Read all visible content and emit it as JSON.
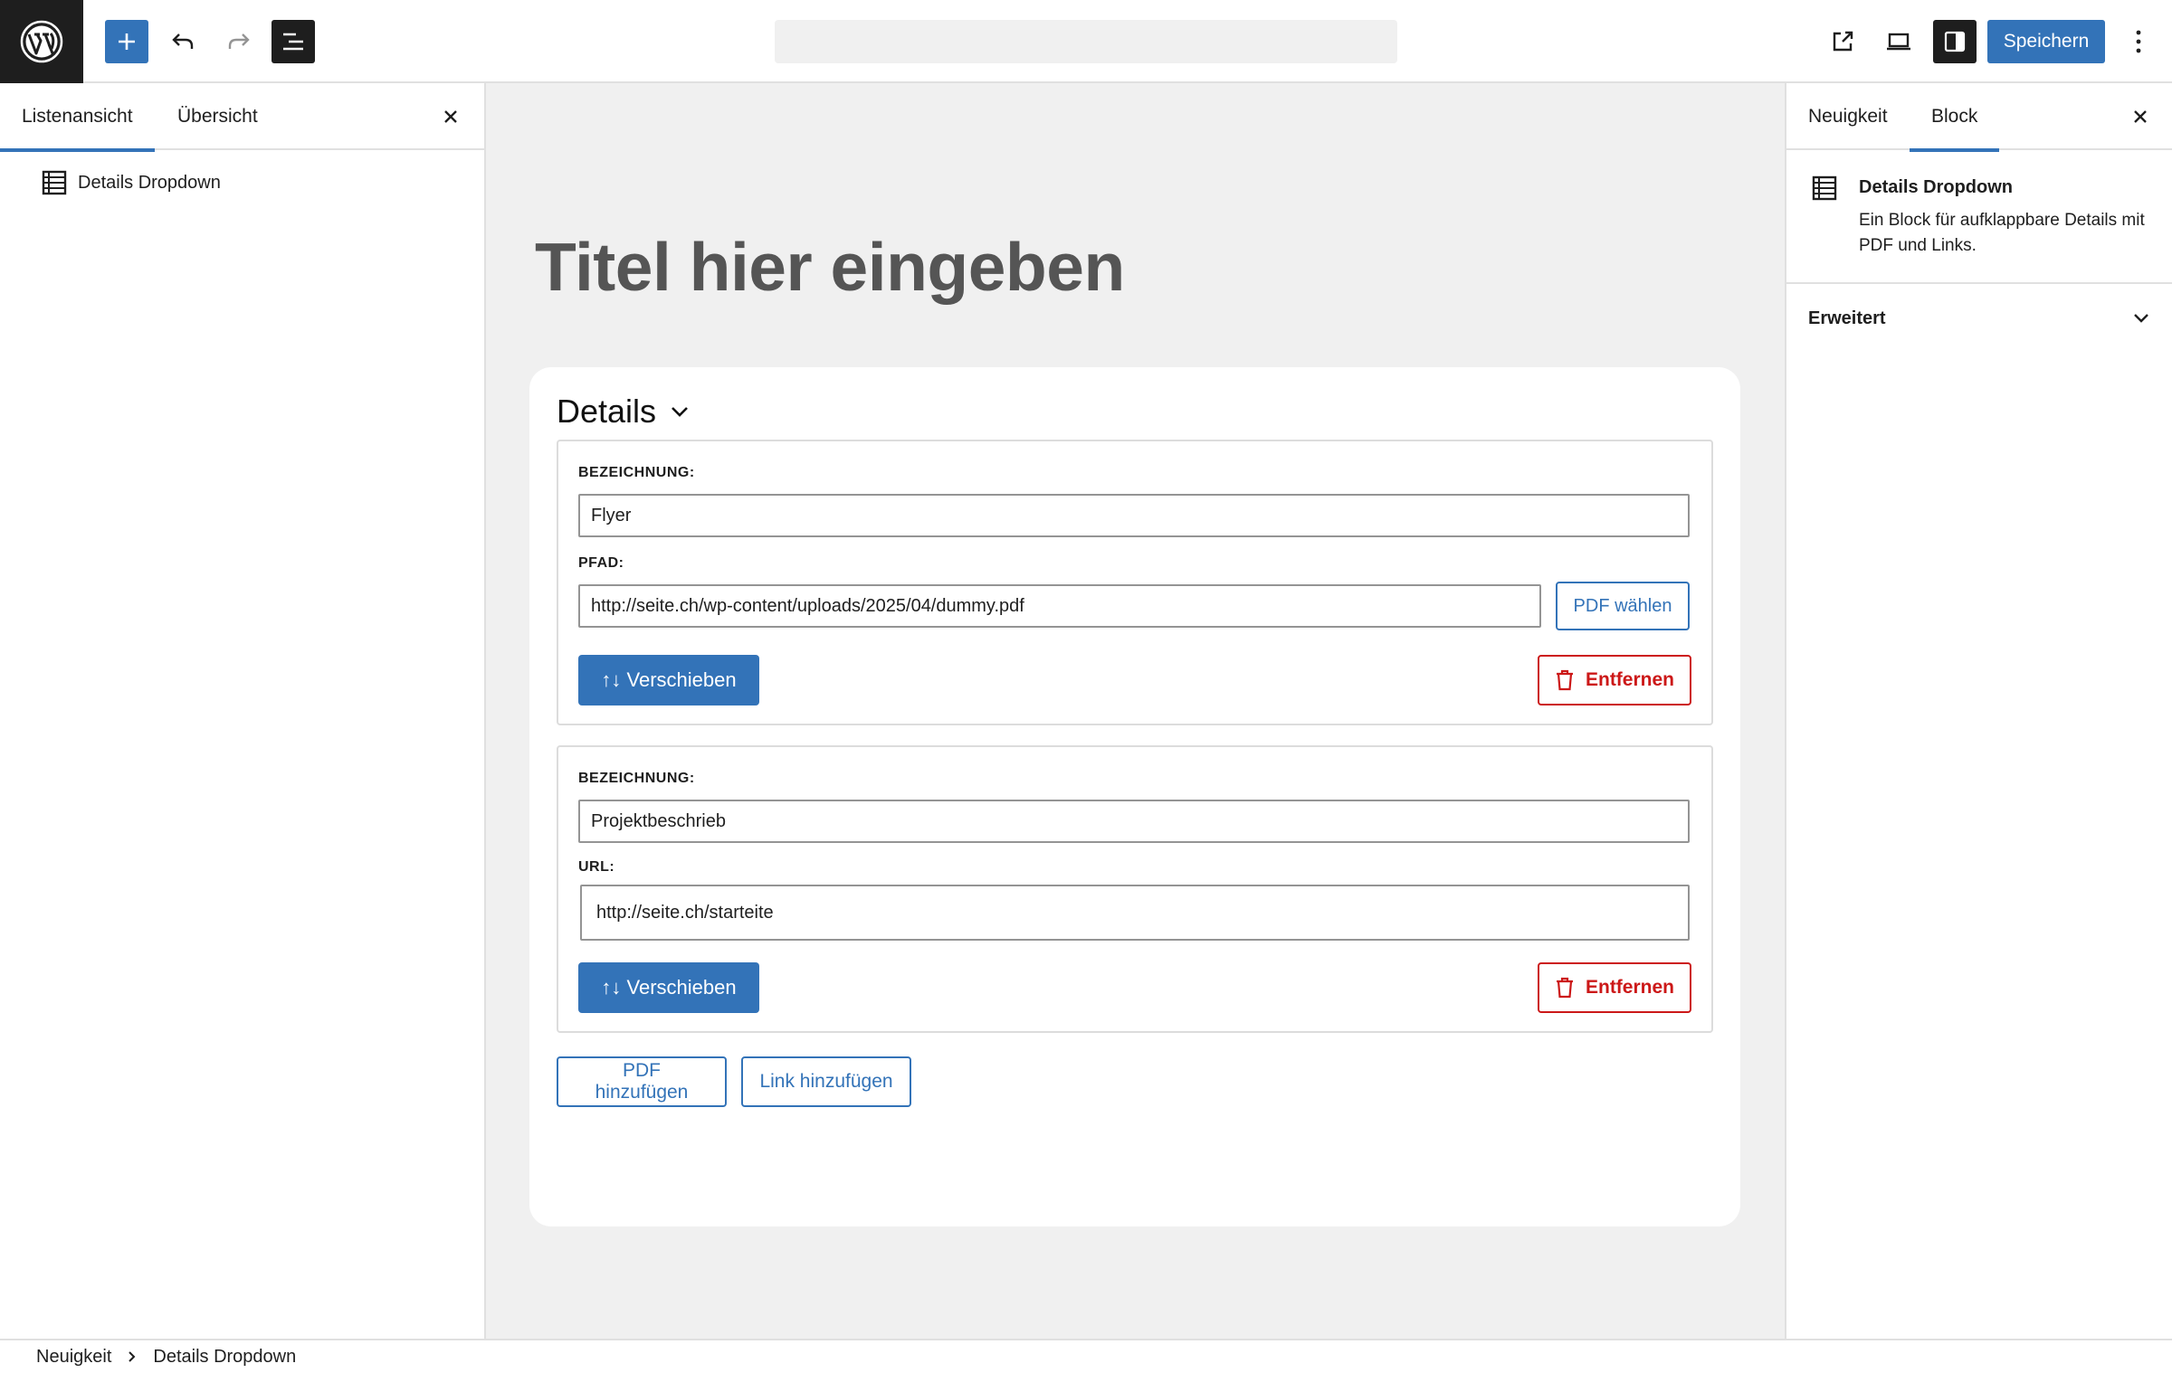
{
  "toolbar": {
    "logo_icon": "wordpress-logo",
    "inserter_icon": "plus-icon",
    "undo_icon": "undo-icon",
    "redo_icon": "redo-icon",
    "document_overview_icon": "list-view-icon",
    "view_post_icon": "external-link-icon",
    "preview_icon": "desktop-icon",
    "settings_icon": "sidebar-icon",
    "save_label": "Speichern",
    "more_icon": "vertical-ellipsis-icon"
  },
  "left_panel": {
    "tabs": [
      {
        "label": "Listenansicht",
        "active": true
      },
      {
        "label": "Übersicht",
        "active": false
      }
    ],
    "items": [
      {
        "label": "Details Dropdown",
        "icon": "table-icon"
      }
    ]
  },
  "canvas": {
    "post_title": "Titel hier eingeben",
    "details": {
      "heading": "Details",
      "entries": [
        {
          "name_label": "BEZEICHNUNG:",
          "name_value": "Flyer",
          "path_label": "PFAD:",
          "path_value": "http://seite.ch/wp-content/uploads/2025/04/dummy.pdf",
          "choose_label": "PDF wählen",
          "move_label": "↑↓ Verschieben",
          "remove_label": "Entfernen"
        },
        {
          "name_label": "BEZEICHNUNG:",
          "name_value": "Projektbeschrieb",
          "path_label": "URL:",
          "path_value": "http://seite.ch/starteite",
          "move_label": "↑↓ Verschieben",
          "remove_label": "Entfernen"
        }
      ],
      "add_pdf_label": "PDF hinzufügen",
      "add_link_label": "Link hinzufügen"
    }
  },
  "right_panel": {
    "tabs": [
      {
        "label": "Neuigkeit",
        "active": false
      },
      {
        "label": "Block",
        "active": true
      }
    ],
    "block": {
      "title": "Details Dropdown",
      "description": "Ein Block für aufklappbare Details mit PDF und Links."
    },
    "advanced_label": "Erweitert"
  },
  "footer": {
    "breadcrumb": [
      "Neuigkeit",
      "Details Dropdown"
    ]
  },
  "colors": {
    "accent": "#3373b8",
    "danger": "#cc1818",
    "dark": "#1e1e1e",
    "canvas_bg": "#f0f0f0"
  }
}
